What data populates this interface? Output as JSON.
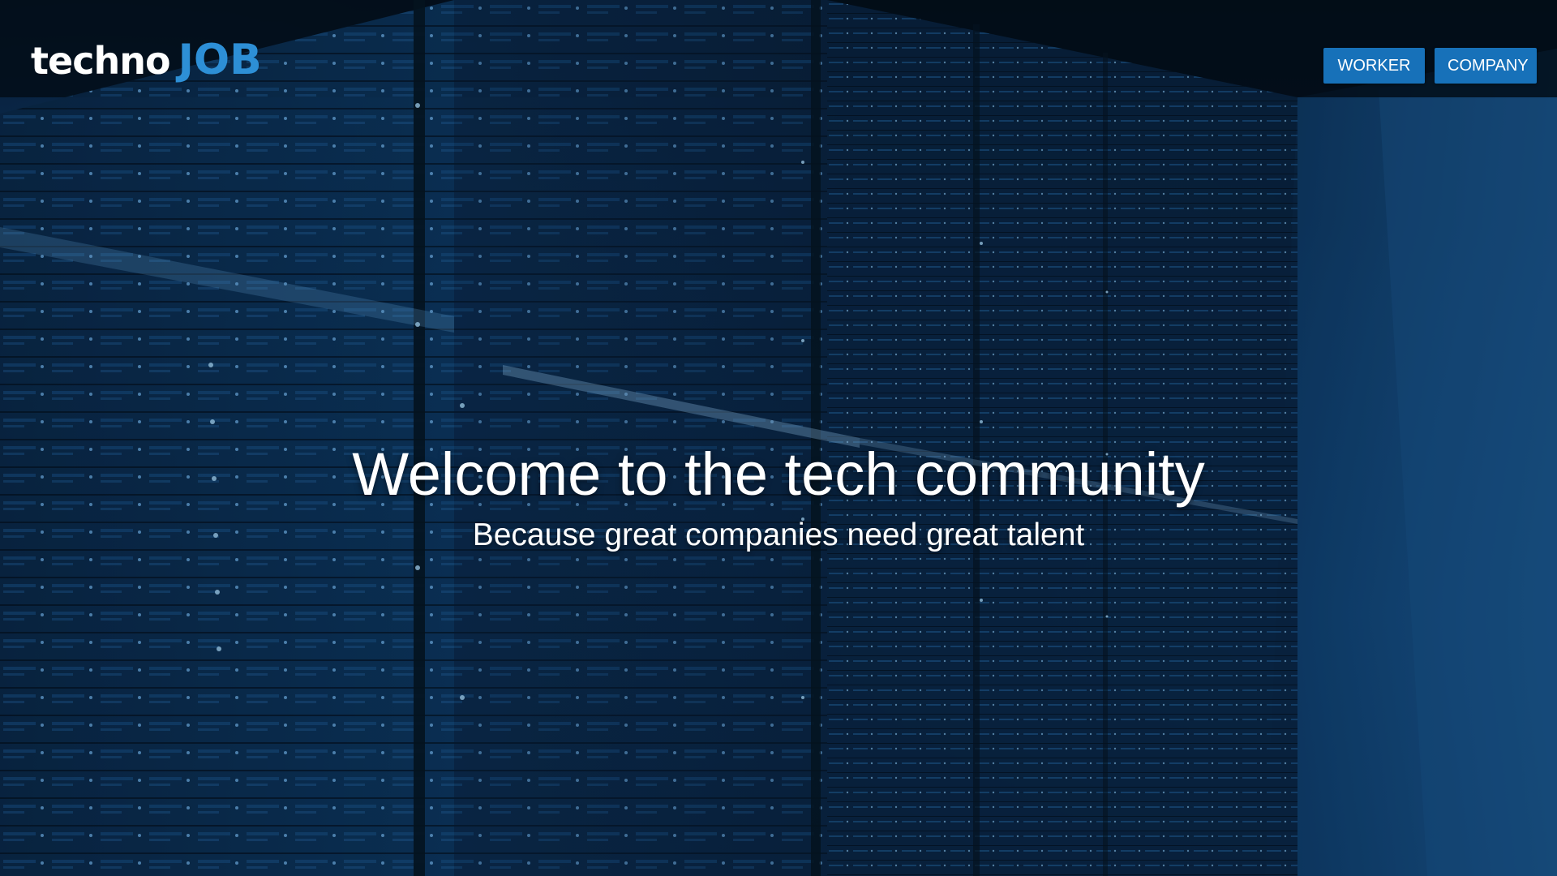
{
  "brand": {
    "logo_part1": "techno",
    "logo_part2": "JOB",
    "logo_part1_color": "#ffffff",
    "logo_part2_color": "#2d8fd6"
  },
  "nav": {
    "worker_label": "WORKER",
    "company_label": "COMPANY",
    "button_color": "#1771b9"
  },
  "hero": {
    "title": "Welcome to the tech community",
    "subtitle": "Because great companies need great talent",
    "background_icon": "server-racks-image"
  }
}
